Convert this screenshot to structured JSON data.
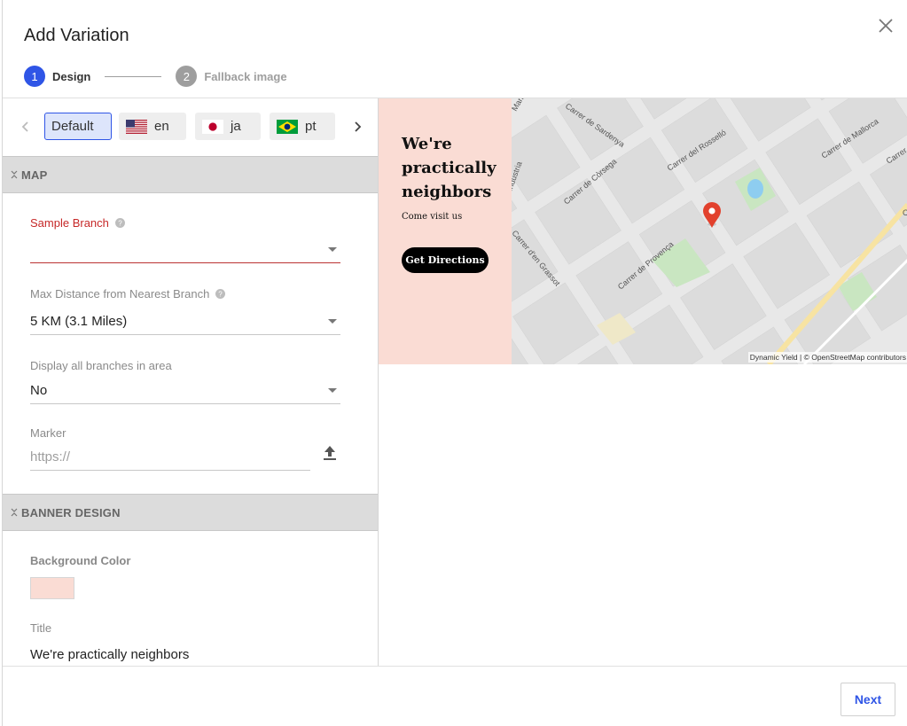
{
  "dialog": {
    "title": "Add Variation",
    "close_icon": "close-icon"
  },
  "stepper": {
    "steps": [
      {
        "number": "1",
        "label": "Design",
        "state": "active"
      },
      {
        "number": "2",
        "label": "Fallback image",
        "state": "inactive"
      }
    ]
  },
  "languages": {
    "prev_icon": "chevron-left-icon",
    "next_icon": "chevron-right-icon",
    "chips": [
      {
        "label": "Default",
        "selected": true
      },
      {
        "label": "en",
        "flag": "us-flag-icon"
      },
      {
        "label": "ja",
        "flag": "japan-flag-icon"
      },
      {
        "label": "pt",
        "flag": "brazil-flag-icon"
      }
    ]
  },
  "map_section": {
    "heading": "MAP",
    "sample_branch_label": "Sample Branch",
    "sample_branch_value": "",
    "max_distance_label": "Max Distance from Nearest Branch",
    "max_distance_value": "5 KM (3.1 Miles)",
    "display_all_label": "Display all branches in area",
    "display_all_value": "No",
    "marker_label": "Marker",
    "marker_placeholder": "https://"
  },
  "banner_section": {
    "heading": "BANNER DESIGN",
    "background_color_label": "Background Color",
    "background_color": "#fadcd4",
    "title_label": "Title",
    "title_value": "We're practically neighbors"
  },
  "preview": {
    "banner_title": "We're practically neighbors",
    "banner_subtitle": "Come visit us",
    "button_label": "Get Directions",
    "attribution": "Dynamic Yield | © OpenStreetMap contributors",
    "street_labels": [
      "Maria",
      "Carrer de Sardenya",
      "Carrer del Rosselló",
      "Carrer de Mallorca",
      "Carrer",
      "Carrer de Còrsega",
      "Indústria",
      "Carrer d'en Grassot",
      "Carrer de Provença",
      "C"
    ],
    "pin_color": "#e2412d"
  },
  "footer": {
    "next_label": "Next"
  },
  "colors": {
    "accent": "#2f55e6",
    "error": "#c62828",
    "banner_bg": "#fadcd4"
  }
}
